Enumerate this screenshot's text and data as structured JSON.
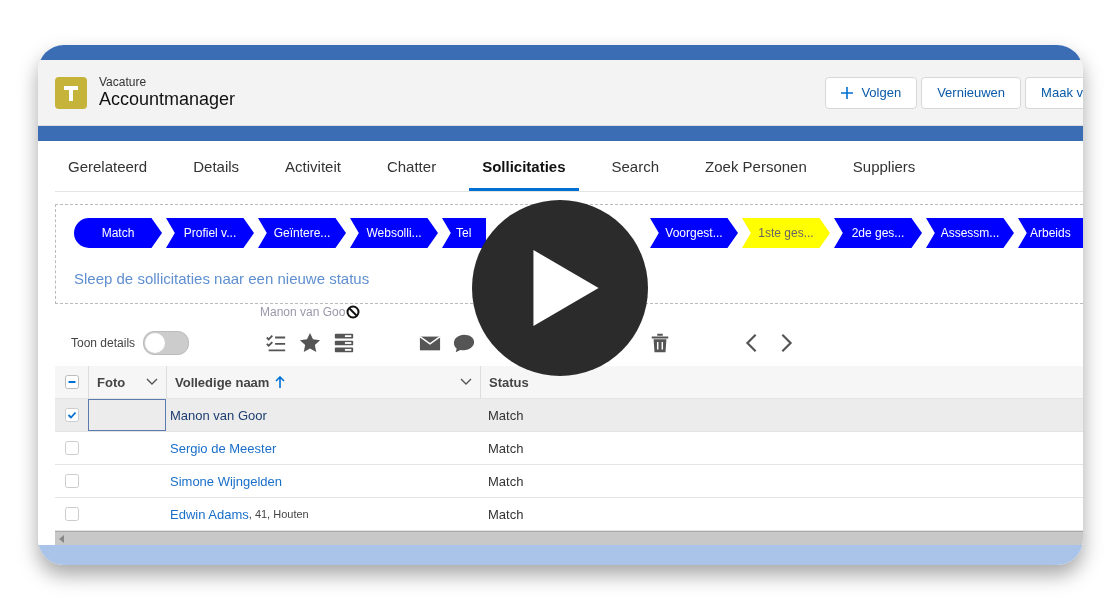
{
  "header": {
    "object_type": "Vacature",
    "title": "Accountmanager",
    "buttons": [
      {
        "label": "Volgen",
        "kind": "follow"
      },
      {
        "label": "Vernieuwen",
        "kind": "plain"
      },
      {
        "label": "Maak v",
        "kind": "plain"
      }
    ]
  },
  "tabs": [
    {
      "label": "Gerelateerd",
      "selected": false
    },
    {
      "label": "Details",
      "selected": false
    },
    {
      "label": "Activiteit",
      "selected": false
    },
    {
      "label": "Chatter",
      "selected": false
    },
    {
      "label": "Sollicitaties",
      "selected": true
    },
    {
      "label": "Search",
      "selected": false
    },
    {
      "label": "Zoek Personen",
      "selected": false
    },
    {
      "label": "Suppliers",
      "selected": false
    }
  ],
  "stages": [
    {
      "label": "Match",
      "selected": false,
      "covered": false
    },
    {
      "label": "Profiel v...",
      "selected": false,
      "covered": false
    },
    {
      "label": "Geïntere...",
      "selected": false,
      "covered": false
    },
    {
      "label": "Websolli...",
      "selected": false,
      "covered": false
    },
    {
      "label": "Tel",
      "selected": false,
      "covered": true
    },
    {
      "label": "Voorgest...",
      "selected": false,
      "covered": false
    },
    {
      "label": "1ste ges...",
      "selected": true,
      "covered": false
    },
    {
      "label": "2de ges...",
      "selected": false,
      "covered": false
    },
    {
      "label": "Assessm...",
      "selected": false,
      "covered": false
    },
    {
      "label": "Arbeids",
      "selected": false,
      "covered": false
    }
  ],
  "drop_hint": "Sleep de sollicitaties naar een nieuwe status",
  "drag_ghost": "Manon van Goo",
  "toolbar": {
    "details_label": "Toon details",
    "details_on": false
  },
  "table": {
    "select_all_partial": true,
    "columns": [
      "Foto",
      "Volledige naam",
      "Status"
    ],
    "rows": [
      {
        "name": "Manon van Goor",
        "status": "Match",
        "checked": true
      },
      {
        "name": "Sergio de Meester",
        "status": "Match",
        "checked": false
      },
      {
        "name": "Simone Wijngelden",
        "status": "Match",
        "checked": false
      },
      {
        "name": "Edwin Adams",
        "extra": ", 41, Houten",
        "status": "Match",
        "checked": false
      }
    ]
  }
}
